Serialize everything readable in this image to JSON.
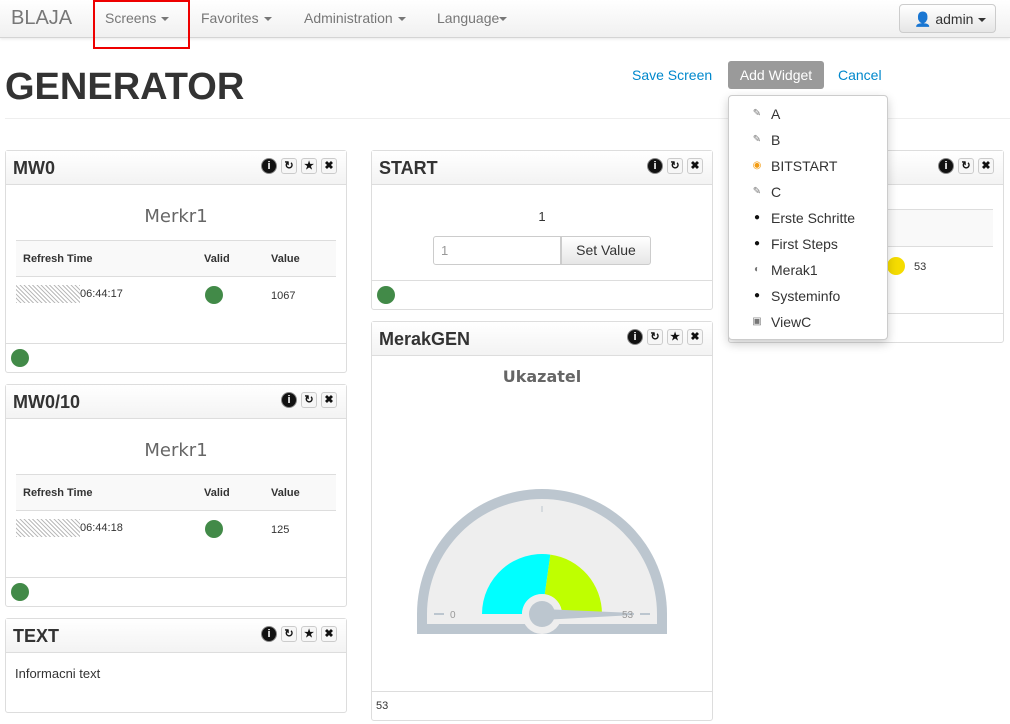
{
  "nav": {
    "brand": "BLAJA",
    "items": [
      "Screens",
      "Favorites",
      "Administration",
      "Language"
    ],
    "user": "admin"
  },
  "page": {
    "title": "GENERATOR",
    "save": "Save Screen",
    "add_widget": "Add Widget",
    "cancel": "Cancel"
  },
  "dropdown": [
    {
      "label": "A",
      "icon": "edit-icon"
    },
    {
      "label": "B",
      "icon": "edit-icon"
    },
    {
      "label": "BITSTART",
      "icon": "bit-icon"
    },
    {
      "label": "C",
      "icon": "edit-icon"
    },
    {
      "label": "Erste Schritte",
      "icon": "info-icon"
    },
    {
      "label": "First Steps",
      "icon": "info-icon"
    },
    {
      "label": "Merak1",
      "icon": "gauge-icon"
    },
    {
      "label": "Systeminfo",
      "icon": "info-icon"
    },
    {
      "label": "ViewC",
      "icon": "window-icon"
    }
  ],
  "mw0": {
    "title": "MW0",
    "subtitle": "Merkr1",
    "headers": [
      "Refresh Time",
      "Valid",
      "Value"
    ],
    "time": "06:44:17",
    "value": "1067"
  },
  "mw010": {
    "title": "MW0/10",
    "subtitle": "Merkr1",
    "headers": [
      "Refresh Time",
      "Valid",
      "Value"
    ],
    "time": "06:44:18",
    "value": "125"
  },
  "text": {
    "title": "TEXT",
    "body": "Informacni text"
  },
  "start": {
    "title": "START",
    "value": "1",
    "input": "1",
    "button": "Set Value"
  },
  "merak": {
    "title": "MerakGEN",
    "subtitle": "Ukazatel",
    "min": "0",
    "max": "53",
    "value": "53",
    "footer": "53",
    "colors": {
      "low": "#00ffff",
      "high": "#bfff00"
    }
  },
  "col3": {
    "value": "53",
    "dot_color": "#f5dc00"
  },
  "colors": {
    "valid": "#428a48",
    "accent": "#0088cc"
  }
}
